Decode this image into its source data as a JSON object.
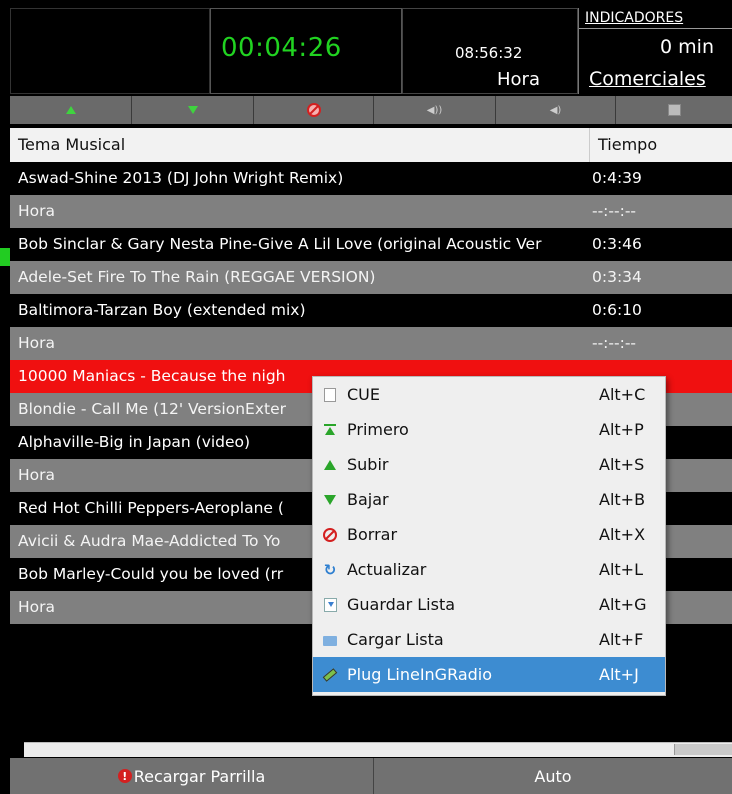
{
  "header": {
    "timer": "00:04:26",
    "clock": "08:56:32",
    "clock_label": "Hora",
    "indicators_title": "INDICADORES",
    "indicator_value": "0 min",
    "indicator_label": "Comerciales"
  },
  "toolbar": {
    "icons": [
      "arrow-up-icon",
      "arrow-down-icon",
      "delete-icon",
      "speaker-icon",
      "speaker-low-icon",
      "image-icon"
    ]
  },
  "table": {
    "columns": {
      "title": "Tema Musical",
      "time": "Tiempo"
    },
    "rows": [
      {
        "title": "Aswad-Shine 2013 (DJ John Wright Remix)",
        "time": "0:4:39",
        "style": "dark"
      },
      {
        "title": "Hora",
        "time": "--:--:--",
        "style": "gray"
      },
      {
        "title": "Bob Sinclar & Gary Nesta Pine-Give A Lil Love (original Acoustic Ver",
        "time": "0:3:46",
        "style": "dark"
      },
      {
        "title": "Adele-Set Fire To The Rain (REGGAE VERSION)",
        "time": "0:3:34",
        "style": "gray"
      },
      {
        "title": "Baltimora-Tarzan Boy (extended mix)",
        "time": "0:6:10",
        "style": "dark"
      },
      {
        "title": "Hora",
        "time": "--:--:--",
        "style": "gray"
      },
      {
        "title": "10000 Maniacs - Because the nigh",
        "time": "",
        "style": "red"
      },
      {
        "title": "Blondie - Call Me (12' VersionExter",
        "time": "",
        "style": "gray"
      },
      {
        "title": "Alphaville-Big in Japan (video)",
        "time": "",
        "style": "dark"
      },
      {
        "title": "Hora",
        "time": "",
        "style": "gray"
      },
      {
        "title": "Red Hot Chilli Peppers-Aeroplane (",
        "time": "",
        "style": "dark"
      },
      {
        "title": "Avicii & Audra Mae-Addicted To Yo",
        "time": "",
        "style": "gray"
      },
      {
        "title": "Bob Marley-Could you be loved (rr",
        "time": "",
        "style": "dark"
      },
      {
        "title": "Hora",
        "time": "",
        "style": "gray"
      }
    ]
  },
  "context_menu": {
    "items": [
      {
        "label": "CUE",
        "shortcut": "Alt+C",
        "icon": "document-icon"
      },
      {
        "label": "Primero",
        "shortcut": "Alt+P",
        "icon": "move-top-icon"
      },
      {
        "label": "Subir",
        "shortcut": "Alt+S",
        "icon": "arrow-up-icon"
      },
      {
        "label": "Bajar",
        "shortcut": "Alt+B",
        "icon": "arrow-down-icon"
      },
      {
        "label": "Borrar",
        "shortcut": "Alt+X",
        "icon": "delete-icon"
      },
      {
        "label": "Actualizar",
        "shortcut": "Alt+L",
        "icon": "refresh-icon"
      },
      {
        "label": "Guardar Lista",
        "shortcut": "Alt+G",
        "icon": "save-icon"
      },
      {
        "label": "Cargar Lista",
        "shortcut": "Alt+F",
        "icon": "folder-icon"
      },
      {
        "label": "Plug LineInGRadio",
        "shortcut": "Alt+J",
        "icon": "plug-icon",
        "selected": true
      }
    ]
  },
  "bottom_bar": {
    "reload_label": "Recargar Parrilla",
    "auto_label": "Auto"
  }
}
